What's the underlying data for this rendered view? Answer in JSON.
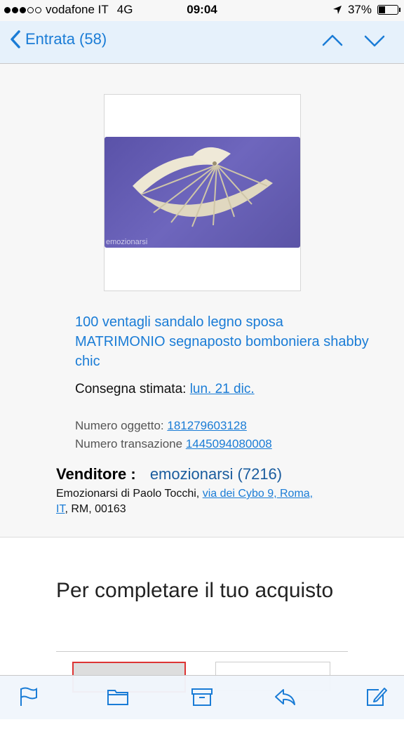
{
  "status_bar": {
    "carrier": "vodafone IT",
    "network": "4G",
    "time": "09:04",
    "battery": "37%"
  },
  "nav": {
    "back_label": "Entrata (58)"
  },
  "product": {
    "image_watermark": "emozionarsi",
    "title": "100 ventagli sandalo legno sposa MATRIMONIO segnaposto bomboniera shabby chic",
    "delivery_label": "Consegna stimata:",
    "delivery_date": "lun. 21 dic.",
    "item_number_label": "Numero oggetto:",
    "item_number": "181279603128",
    "transaction_label": "Numero transazione",
    "transaction_number": "1445094080008"
  },
  "seller": {
    "label": "Venditore :",
    "name": "emozionarsi (7216)",
    "address_name": "Emozionarsi di Paolo Tocchi,",
    "address_street": "via dei Cybo 9, Roma,",
    "address_country": "IT",
    "address_rest": ", RM, 00163"
  },
  "section": {
    "title": "Per completare il tuo acquisto"
  },
  "colors": {
    "link": "#1a7cd6",
    "title_link": "#1a5c9e",
    "nav_bg": "#e6f1fb"
  }
}
